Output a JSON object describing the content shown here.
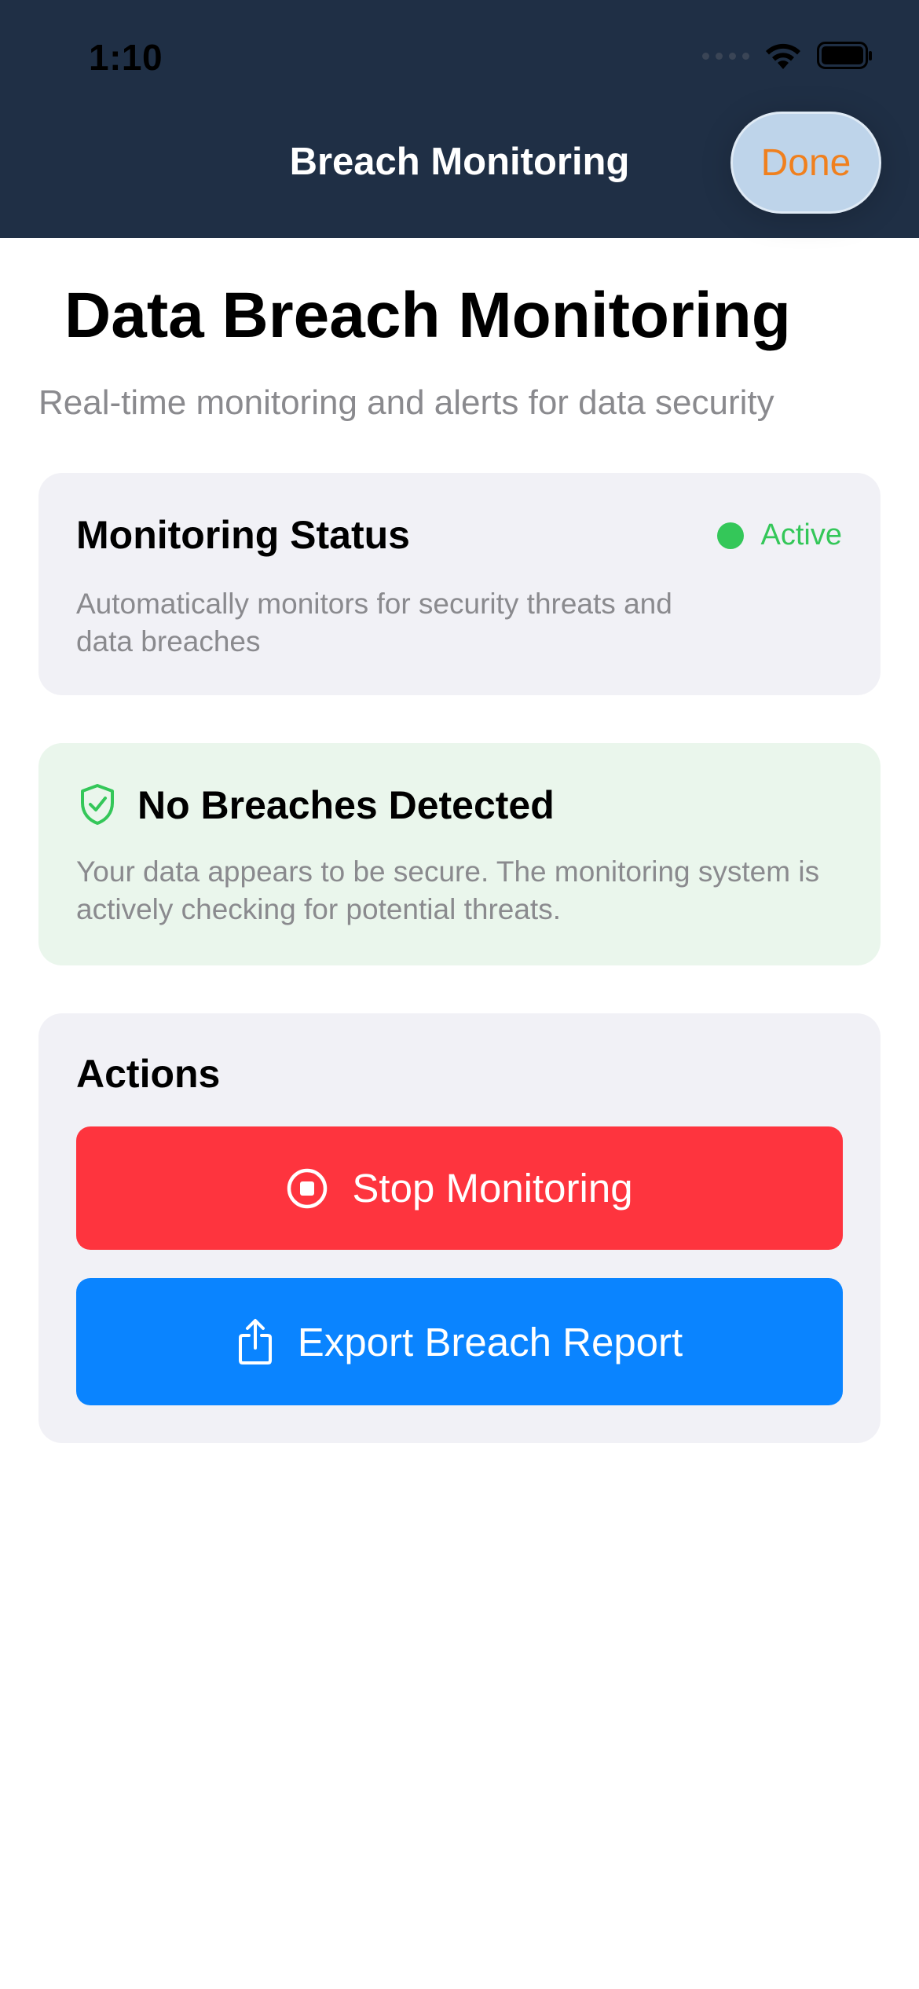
{
  "status_bar": {
    "time": "1:10"
  },
  "nav": {
    "title": "Breach Monitoring",
    "done_label": "Done",
    "done_color": "#f0801e",
    "background": "#1f2f45"
  },
  "page": {
    "title": "Data Breach Monitoring",
    "subtitle": "Real-time monitoring and alerts for data security"
  },
  "monitoring_status": {
    "title": "Monitoring Status",
    "status": "Active",
    "status_color": "#34c759",
    "description": "Automatically monitors for security threats and data breaches"
  },
  "breach_result": {
    "icon": "shield-check-icon",
    "title": "No Breaches Detected",
    "description": "Your data appears to be secure. The monitoring system is actively checking for potential threats."
  },
  "actions": {
    "title": "Actions",
    "stop": {
      "icon": "stop-circle-icon",
      "label": "Stop Monitoring",
      "color": "#fe343e"
    },
    "export": {
      "icon": "share-icon",
      "label": "Export Breach Report",
      "color": "#0a84ff"
    }
  }
}
